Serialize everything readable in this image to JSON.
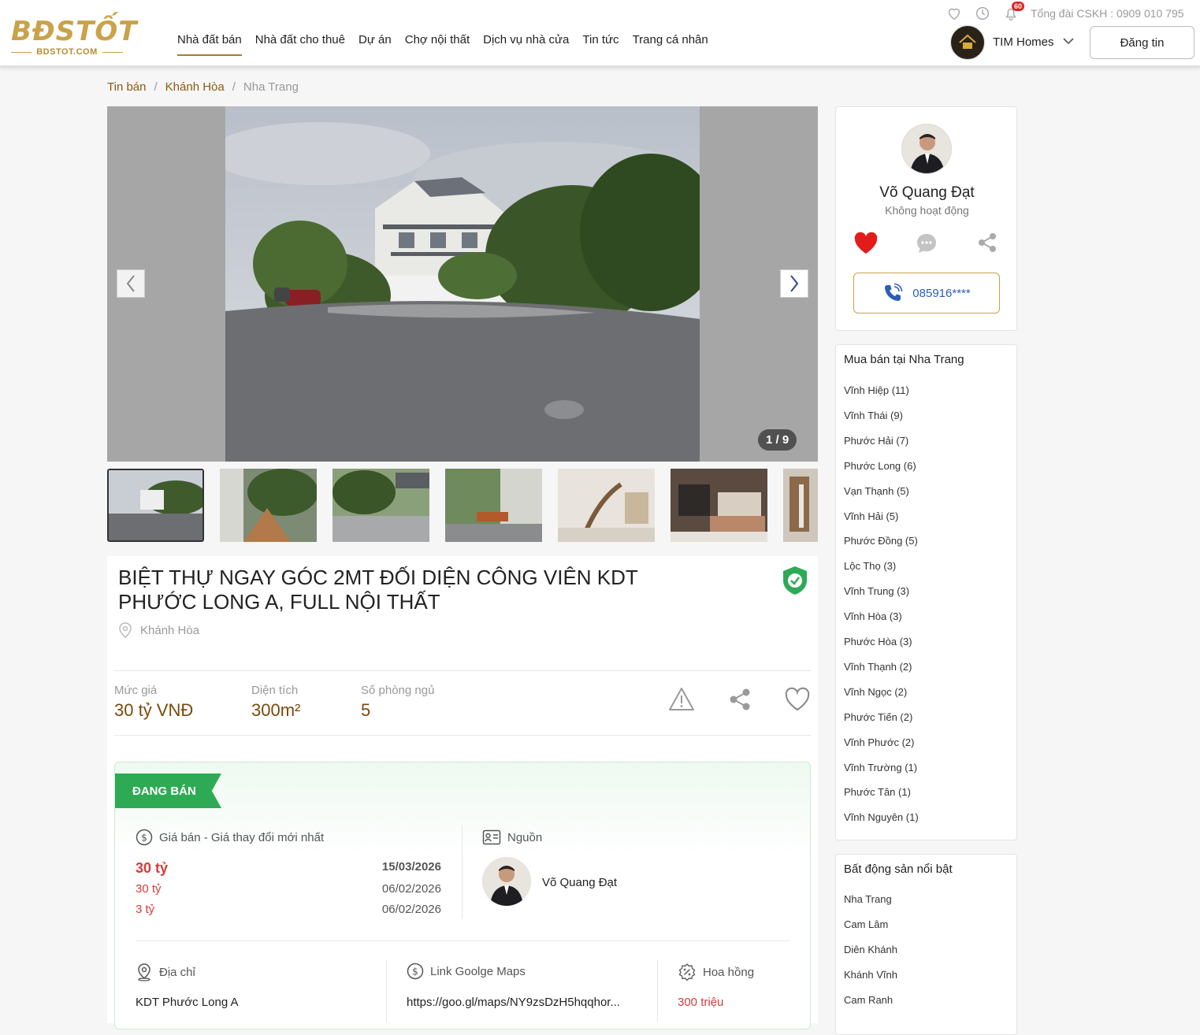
{
  "header": {
    "logo_main": "BĐSTỐT",
    "logo_sub": "BDSTOT.COM",
    "nav": [
      "Nhà đất bán",
      "Nhà đất cho thuê",
      "Dự án",
      "Chợ nội thất",
      "Dịch vụ nhà cửa",
      "Tin tức",
      "Trang cá nhân"
    ],
    "notification_count": "60",
    "hotline": "Tổng đài CSKH : 0909 010 795",
    "user_name": "TIM Homes",
    "post_button": "Đăng tin"
  },
  "breadcrumb": {
    "items": [
      "Tin bán",
      "Khánh Hòa"
    ],
    "current": "Nha Trang",
    "separator": "/"
  },
  "gallery": {
    "counter": "1 / 9"
  },
  "listing": {
    "title": "BIỆT THỰ NGAY GÓC 2MT ĐỐI DIỆN CÔNG VIÊN KDT PHƯỚC LONG A, FULL NỘI THẤT",
    "location": "Khánh Hòa",
    "stats": [
      {
        "label": "Mức giá",
        "value": "30 tỷ VNĐ"
      },
      {
        "label": "Diện tích",
        "value": "300m²"
      },
      {
        "label": "Số phòng ngủ",
        "value": "5"
      }
    ],
    "status": "ĐANG BÁN",
    "price_section": {
      "heading": "Giá bán - Giá thay đổi mới nhất",
      "rows": [
        {
          "price": "30 tỷ",
          "date": "15/03/2026"
        },
        {
          "price": "30 tỷ",
          "date": "06/02/2026"
        },
        {
          "price": "3 tỷ",
          "date": "06/02/2026"
        }
      ]
    },
    "source_section": {
      "heading": "Nguồn",
      "name": "Võ Quang Đạt"
    },
    "address": {
      "heading": "Địa chỉ",
      "value": "KDT Phước Long A"
    },
    "maps": {
      "heading": "Link Goolge Maps",
      "value": "https://goo.gl/maps/NY9zsDzH5hqqhor..."
    },
    "commission": {
      "heading": "Hoa hồng",
      "value": "300 triệu"
    }
  },
  "agent": {
    "name": "Võ Quang Đạt",
    "status": "Không hoạt động",
    "phone": "085916****"
  },
  "area_list": {
    "title": "Mua bán tại Nha Trang",
    "items": [
      "Vĩnh Hiệp (11)",
      "Vĩnh Thái (9)",
      "Phước Hải (7)",
      "Phước Long (6)",
      "Vạn Thạnh (5)",
      "Vĩnh Hải (5)",
      "Phước Đồng (5)",
      "Lộc Thọ (3)",
      "Vĩnh Trung (3)",
      "Vĩnh Hòa (3)",
      "Phước Hòa (3)",
      "Vĩnh Thạnh (2)",
      "Vĩnh Ngọc (2)",
      "Phước Tiến (2)",
      "Vĩnh Phước (2)",
      "Vĩnh Trường (1)",
      "Phước Tân (1)",
      "Vĩnh Nguyên (1)"
    ]
  },
  "featured_list": {
    "title": "Bất động sản nổi bật",
    "items": [
      "Nha Trang",
      "Cam Lâm",
      "Diên Khánh",
      "Khánh Vĩnh",
      "Cam Ranh"
    ]
  },
  "colors": {
    "brand_gold": "#c9a24a",
    "price_brown": "#7a4a0a",
    "status_green": "#2eaa55",
    "price_red": "#d83a3a",
    "heart_red": "#e31b1b"
  }
}
